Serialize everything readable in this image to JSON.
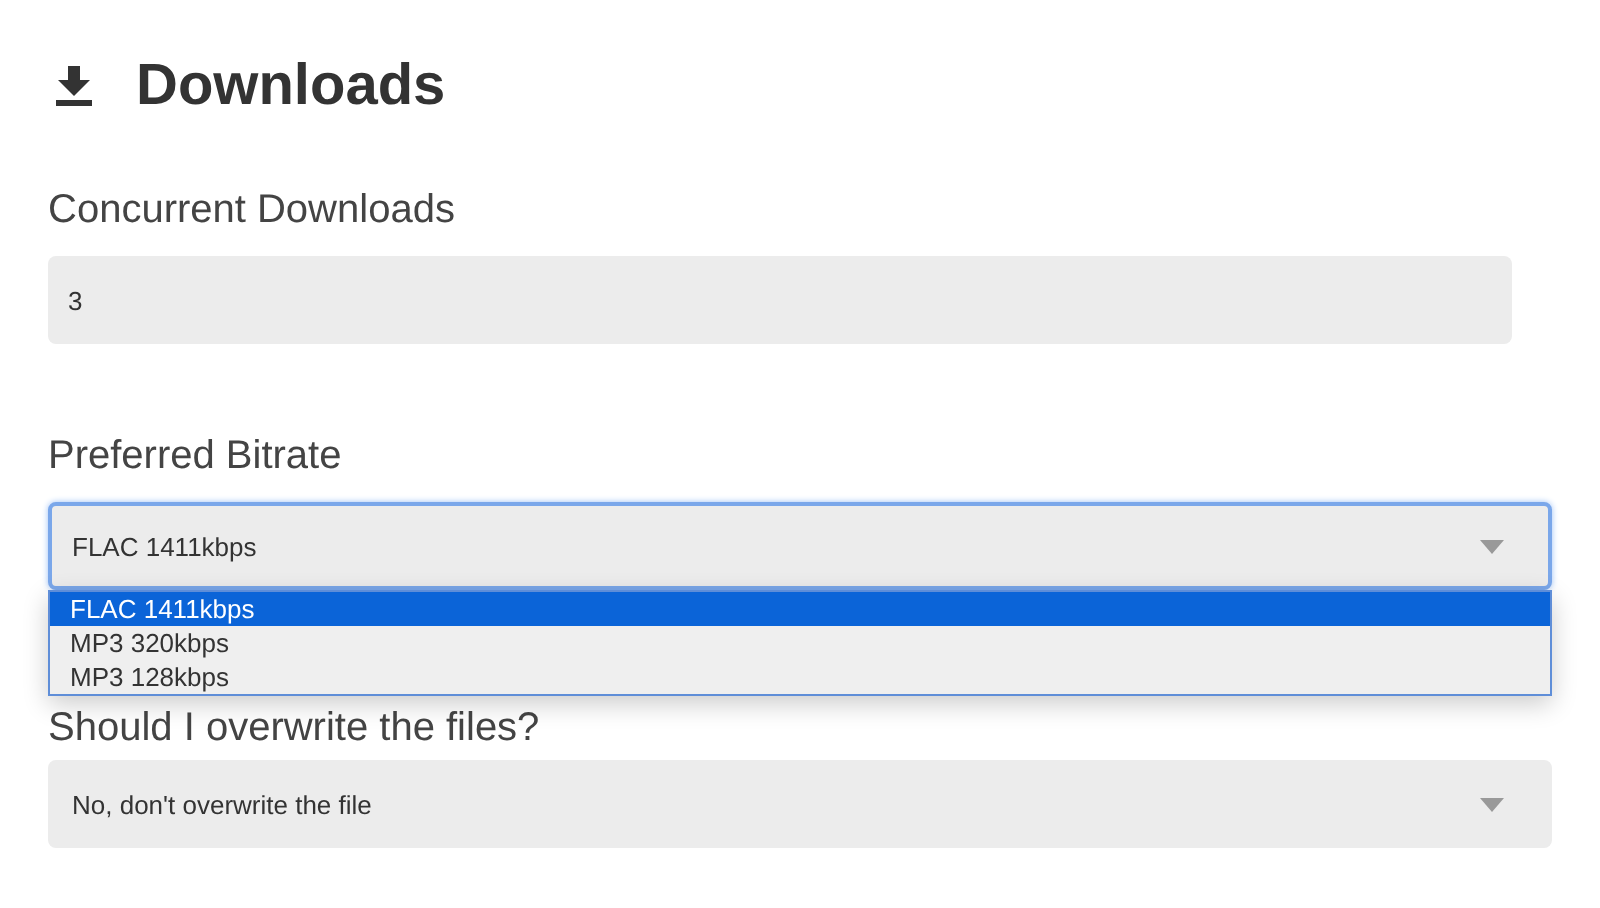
{
  "heading": {
    "title": "Downloads"
  },
  "fields": [
    {
      "kind": "number",
      "label": "Concurrent Downloads",
      "value": "3"
    },
    {
      "kind": "select",
      "label": "Preferred Bitrate",
      "value": "FLAC 1411kbps",
      "open": true,
      "options": [
        {
          "label": "FLAC 1411kbps",
          "selected": true
        },
        {
          "label": "MP3 320kbps",
          "selected": false
        },
        {
          "label": "MP3 128kbps",
          "selected": false
        }
      ]
    },
    {
      "kind": "select",
      "label": "Should I overwrite the files?",
      "value": "No, don't overwrite the file",
      "open": false
    }
  ]
}
